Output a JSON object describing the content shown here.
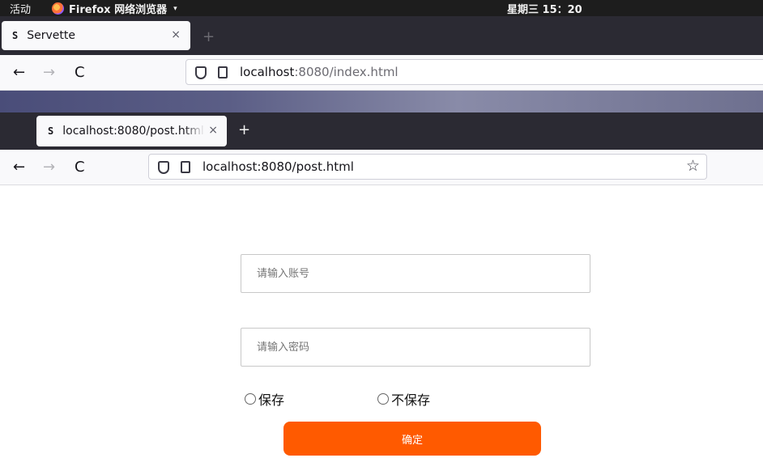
{
  "topbar": {
    "activities": "活动",
    "app_name": "Firefox 网络浏览器",
    "app_menu_caret": "▾",
    "clock": "星期三 15：20"
  },
  "back_window": {
    "tab": {
      "favicon": "S",
      "title": "Servette",
      "close": "×"
    },
    "new_tab": "+",
    "nav": {
      "back": "←",
      "forward": "→",
      "reload": "C"
    },
    "url": {
      "host": "localhost",
      "rest": ":8080/index.html"
    }
  },
  "front_window": {
    "tab": {
      "favicon": "S",
      "title": "localhost:8080/post.html",
      "close": "×"
    },
    "new_tab": "+",
    "nav": {
      "back": "←",
      "forward": "→",
      "reload": "C"
    },
    "url": {
      "text": "localhost:8080/post.html"
    },
    "bookmark_star": "☆"
  },
  "form": {
    "account_placeholder": "请输入账号",
    "password_placeholder": "请输入密码",
    "radio_save": "保存",
    "radio_nosave": "不保存",
    "submit_label": "确定",
    "submit_color": "#ff5a00"
  }
}
